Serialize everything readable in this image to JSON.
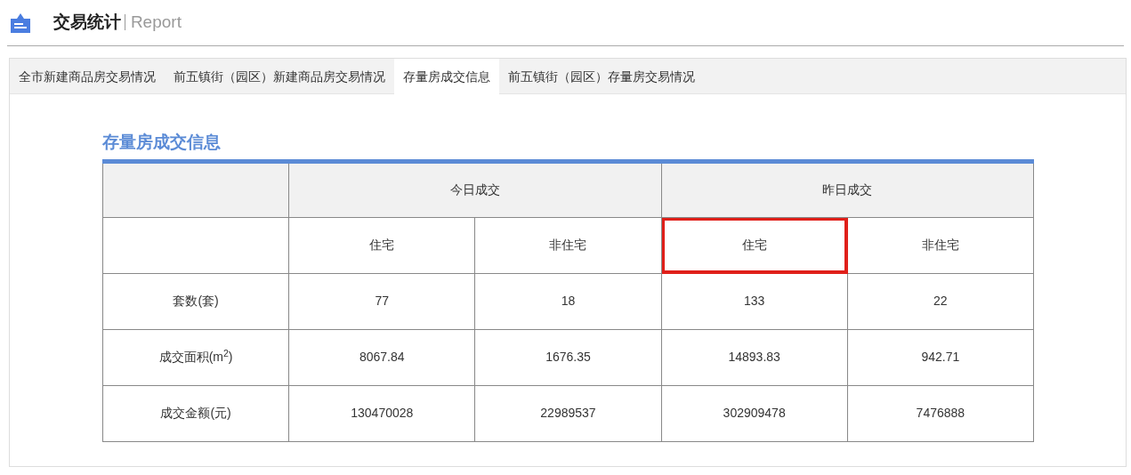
{
  "header": {
    "title": "交易统计",
    "subtitle": "Report"
  },
  "tabs": [
    {
      "label": "全市新建商品房交易情况",
      "selected": false
    },
    {
      "label": "前五镇街（园区）新建商品房交易情况",
      "selected": false
    },
    {
      "label": "存量房成交信息",
      "selected": true
    },
    {
      "label": "前五镇街（园区）存量房交易情况",
      "selected": false
    }
  ],
  "section_title": "存量房成交信息",
  "table": {
    "groups": [
      "今日成交",
      "昨日成交"
    ],
    "subheaders": [
      {
        "label": "住宅",
        "highlighted": false
      },
      {
        "label": "非住宅",
        "highlighted": false
      },
      {
        "label": "住宅",
        "highlighted": true
      },
      {
        "label": "非住宅",
        "highlighted": false
      }
    ],
    "rows": [
      {
        "label": "套数(套)",
        "values": [
          "77",
          "18",
          "133",
          "22"
        ]
      },
      {
        "label": "成交面积(m$^{2}$)",
        "values": [
          "8067.84",
          "1676.35",
          "14893.83",
          "942.71"
        ]
      },
      {
        "label": "成交金额(元)",
        "values": [
          "130470028",
          "22989537",
          "302909478",
          "7476888"
        ]
      }
    ]
  }
}
